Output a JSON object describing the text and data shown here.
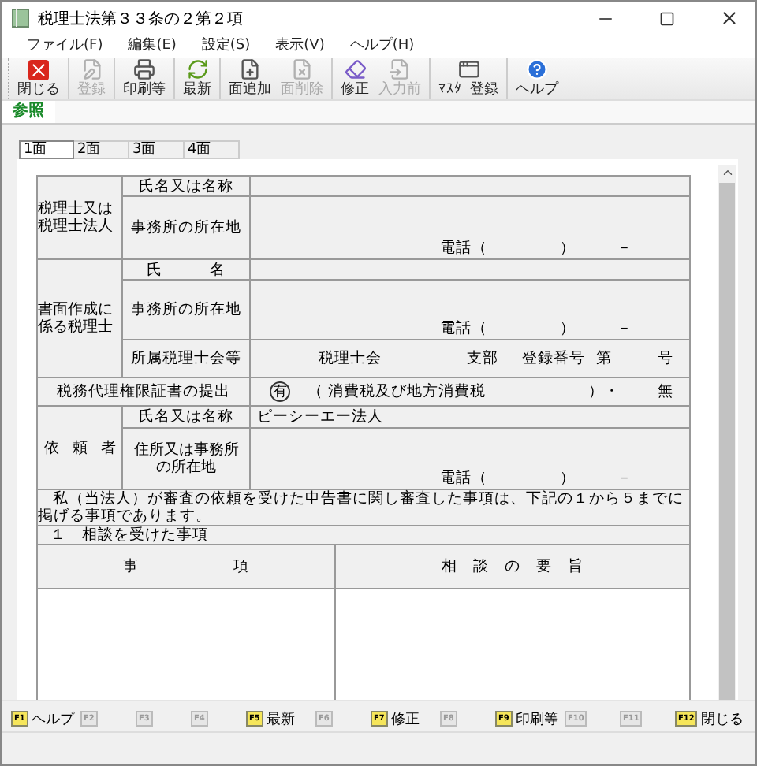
{
  "window": {
    "title": "税理士法第３３条の２第２項"
  },
  "menu": [
    "ファイル(F)",
    "編集(E)",
    "設定(S)",
    "表示(V)",
    "ヘルプ(H)"
  ],
  "toolbar": [
    [
      {
        "kind": "close",
        "label": "閉じる",
        "disabled": false
      }
    ],
    [
      {
        "kind": "register",
        "label": "登録",
        "disabled": true
      }
    ],
    [
      {
        "kind": "print",
        "label": "印刷等",
        "disabled": false
      }
    ],
    [
      {
        "kind": "refresh",
        "label": "最新",
        "disabled": false
      }
    ],
    [
      {
        "kind": "add_page",
        "label": "面追加",
        "disabled": false
      },
      {
        "kind": "delete_page",
        "label": "面削除",
        "disabled": true
      }
    ],
    [
      {
        "kind": "edit",
        "label": "修正",
        "disabled": false
      },
      {
        "kind": "undo",
        "label": "入力前",
        "disabled": true
      }
    ],
    [
      {
        "kind": "master",
        "label": "ﾏｽﾀｰ登録",
        "disabled": false
      }
    ],
    [
      {
        "kind": "help",
        "label": "ヘルプ",
        "disabled": false
      }
    ]
  ],
  "view_tabs": [
    {
      "label": "参照",
      "selected": true
    }
  ],
  "page_tabs": [
    {
      "label": "1面",
      "selected": true
    },
    {
      "label": "2面",
      "selected": false
    },
    {
      "label": "3面",
      "selected": false
    },
    {
      "label": "4面",
      "selected": false
    }
  ],
  "form": {
    "accountant": {
      "group": [
        "税理士又は",
        "税理士法人"
      ],
      "name_label": "氏名又は名称",
      "office_label": "事務所の所在地",
      "phone": [
        "電話（",
        "）",
        "－"
      ]
    },
    "preparer": {
      "group": [
        "書面作成に",
        "係る税理士"
      ],
      "name_label": "氏　　　名",
      "office_label": "事務所の所在地",
      "phone": [
        "電話（",
        "）",
        "－"
      ],
      "association_label": "所属税理士会等",
      "association": [
        "税理士会",
        "支部",
        "登録番号",
        "第",
        "号"
      ]
    },
    "power_of_attorney": {
      "label": "税務代理権限証書の提出",
      "yes": "有",
      "yes_circled": true,
      "detail": "（ 消費税及び地方消費税",
      "close": "）・",
      "no": "無"
    },
    "client": {
      "group": "依　頼　者",
      "name_label": "氏名又は名称",
      "name_value": "ピーシーエー法人",
      "address_label": [
        "住所又は事務所",
        "の所在地"
      ],
      "phone": [
        "電話（",
        "）",
        "－"
      ]
    },
    "statement": "私（当法人）が審査の依頼を受けた申告書に関し審査した事項は、下記の１から５までに掲げる事項であります。",
    "section_title": "１　相談を受けた事項",
    "columns": [
      "事　　　　　　項",
      "相　談　の　要　旨"
    ]
  },
  "function_keys": [
    {
      "key": "F1",
      "label": "ヘルプ",
      "disabled": false
    },
    {
      "key": "F2",
      "disabled": true
    },
    {
      "key": "F3",
      "disabled": true
    },
    {
      "key": "F4",
      "disabled": true
    },
    {
      "key": "F5",
      "label": "最新",
      "disabled": false
    },
    {
      "key": "F6",
      "disabled": true
    },
    {
      "key": "F7",
      "label": "修正",
      "disabled": false
    },
    {
      "key": "F8",
      "disabled": true
    },
    {
      "key": "F9",
      "label": "印刷等",
      "disabled": false
    },
    {
      "key": "F10",
      "disabled": true
    },
    {
      "key": "F11",
      "disabled": true
    },
    {
      "key": "F12",
      "label": "閉じる",
      "disabled": false
    }
  ]
}
